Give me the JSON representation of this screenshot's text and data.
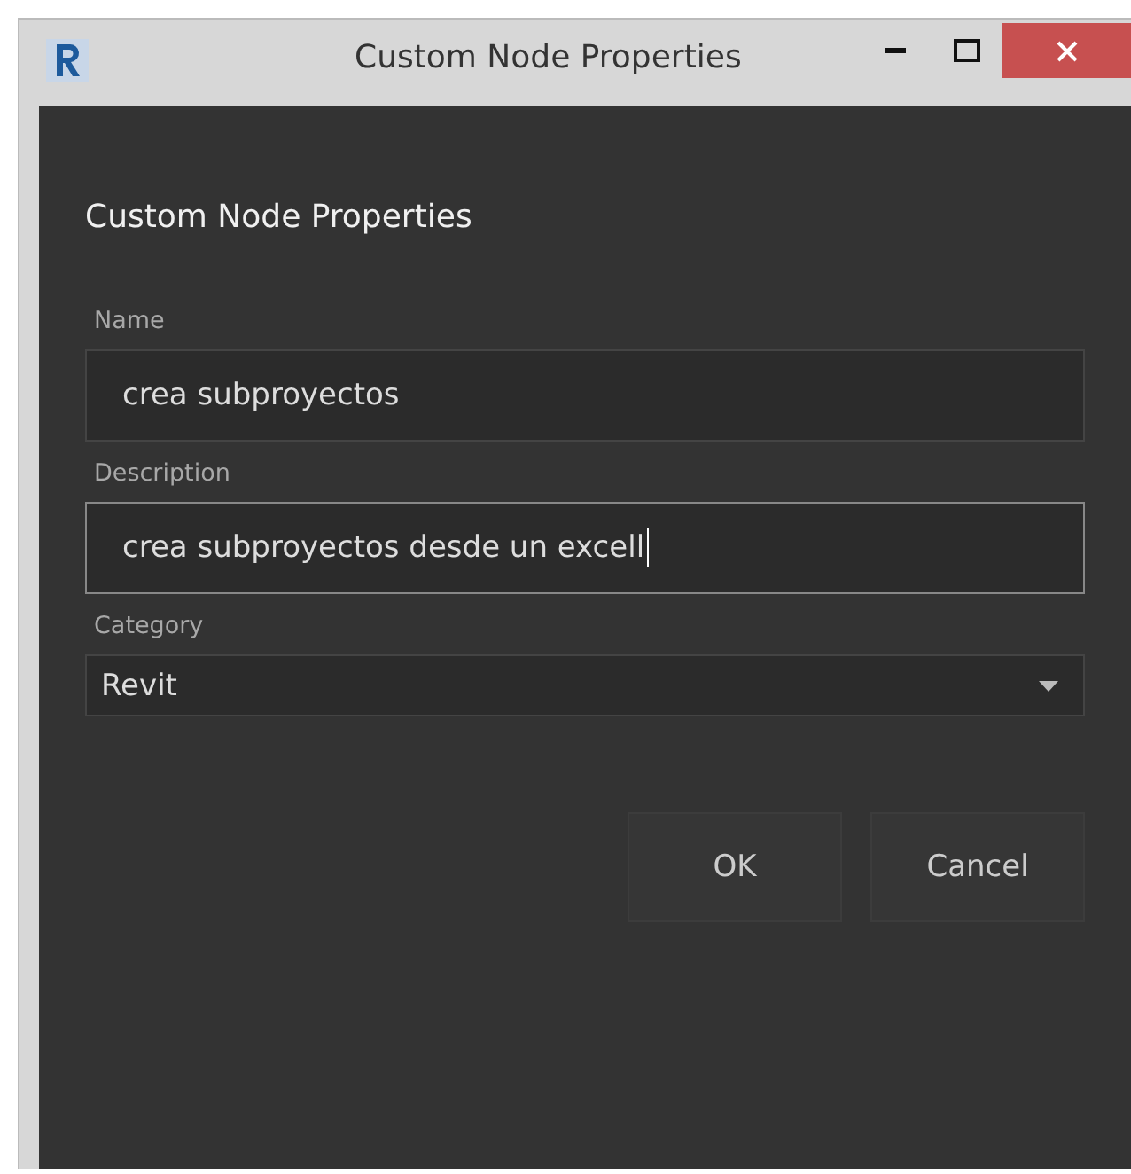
{
  "window": {
    "title": "Custom Node Properties"
  },
  "heading": "Custom Node Properties",
  "fields": [
    {
      "kind": "text",
      "label": "Name",
      "value": "crea subproyectos",
      "focused": false
    },
    {
      "kind": "text",
      "label": "Description",
      "value": "crea subproyectos desde un excell",
      "focused": true
    },
    {
      "kind": "select",
      "label": "Category",
      "value": "Revit",
      "focused": false
    }
  ],
  "buttons": [
    "OK",
    "Cancel"
  ]
}
